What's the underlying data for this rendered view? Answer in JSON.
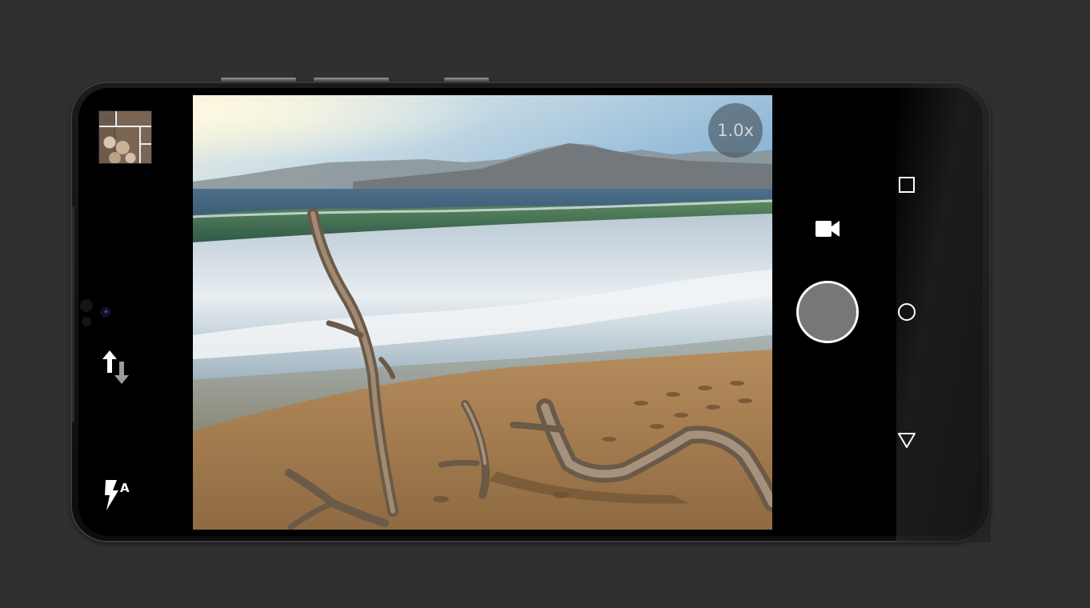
{
  "camera": {
    "zoom_label": "1.0x"
  },
  "icons": {
    "gallery": "gallery-thumbnail",
    "switch_camera": "switch-camera-icon",
    "flash": "flash-auto-icon",
    "video": "video-camera-icon",
    "shutter": "shutter-button",
    "nav_recents": "square-recents-icon",
    "nav_home": "circle-home-icon",
    "nav_back": "triangle-back-icon"
  },
  "colors": {
    "background": "#303030",
    "screen": "#000000",
    "shutter_fill": "#777777",
    "shutter_ring": "#ffffff",
    "zoom_badge": "#46505a",
    "icon": "#ffffff"
  }
}
